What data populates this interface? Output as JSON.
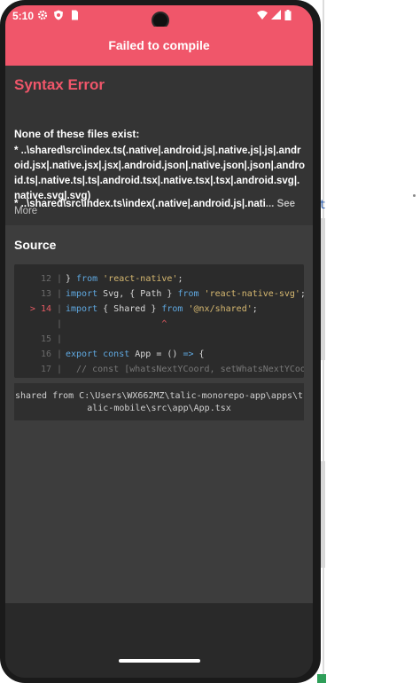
{
  "status_bar": {
    "time": "5:10",
    "icons": [
      "gear-icon",
      "shield-icon",
      "sim-icon",
      "wifi-icon",
      "signal-icon",
      "battery-icon"
    ]
  },
  "title_bar": {
    "title": "Failed to compile"
  },
  "error": {
    "title": "Syntax Error",
    "heading": "None of these files exist:",
    "line1": "  * ..\\shared\\src\\index.ts(.native|.android.js|.native.js|.js|.android.jsx|.native.jsx|.jsx|.android.json|.native.json|.json|.android.ts|.native.ts|.ts|.android.tsx|.native.tsx|.tsx|.android.svg|.native.svg|.svg)",
    "line2": "  * ..\\shared\\src\\index.ts\\index(.native|.android.js|.nati",
    "ellipsis": "...",
    "see_more": "See More",
    "see_more_1": "See",
    "see_more_2": "More"
  },
  "source": {
    "title": "Source",
    "lines": [
      {
        "num": "12",
        "marker": "",
        "code": [
          [
            "",
            "} "
          ],
          [
            "kw",
            "from"
          ],
          [
            "str",
            " 'react-native'"
          ],
          [
            "",
            ";"
          ]
        ]
      },
      {
        "num": "13",
        "marker": "",
        "code": [
          [
            "kw",
            "import"
          ],
          [
            "",
            " Svg, { Path } "
          ],
          [
            "kw",
            "from"
          ],
          [
            "str",
            " 'react-native-svg'"
          ],
          [
            "",
            ";"
          ]
        ]
      },
      {
        "num": "14",
        "marker": ">",
        "code": [
          [
            "kw",
            "import"
          ],
          [
            "",
            " { Shared } "
          ],
          [
            "kw",
            "from"
          ],
          [
            "str",
            " '@nx/shared'"
          ],
          [
            "",
            ";"
          ]
        ]
      },
      {
        "num": "",
        "marker": "",
        "code": [
          [
            "caret",
            "                  ^"
          ]
        ]
      },
      {
        "num": "15",
        "marker": "",
        "code": [
          [
            "",
            ""
          ]
        ]
      },
      {
        "num": "16",
        "marker": "",
        "code": [
          [
            "kw",
            "export const"
          ],
          [
            "",
            " App = () "
          ],
          [
            "kw",
            "=>"
          ],
          [
            "",
            " {"
          ]
        ]
      },
      {
        "num": "17",
        "marker": "",
        "code": [
          [
            "cmt",
            "  // const [whatsNextYCoord, setWhatsNextYCoo"
          ]
        ]
      }
    ],
    "path_line1": "shared from C:\\Users\\WX662MZ\\talic-monorepo-app\\apps\\t",
    "path_line2": "alic-mobile\\src\\app\\App.tsx"
  },
  "colors": {
    "accent": "#f0566a",
    "keyword": "#5fa8e0",
    "string": "#d6b870",
    "highlight": "#e55b63"
  }
}
